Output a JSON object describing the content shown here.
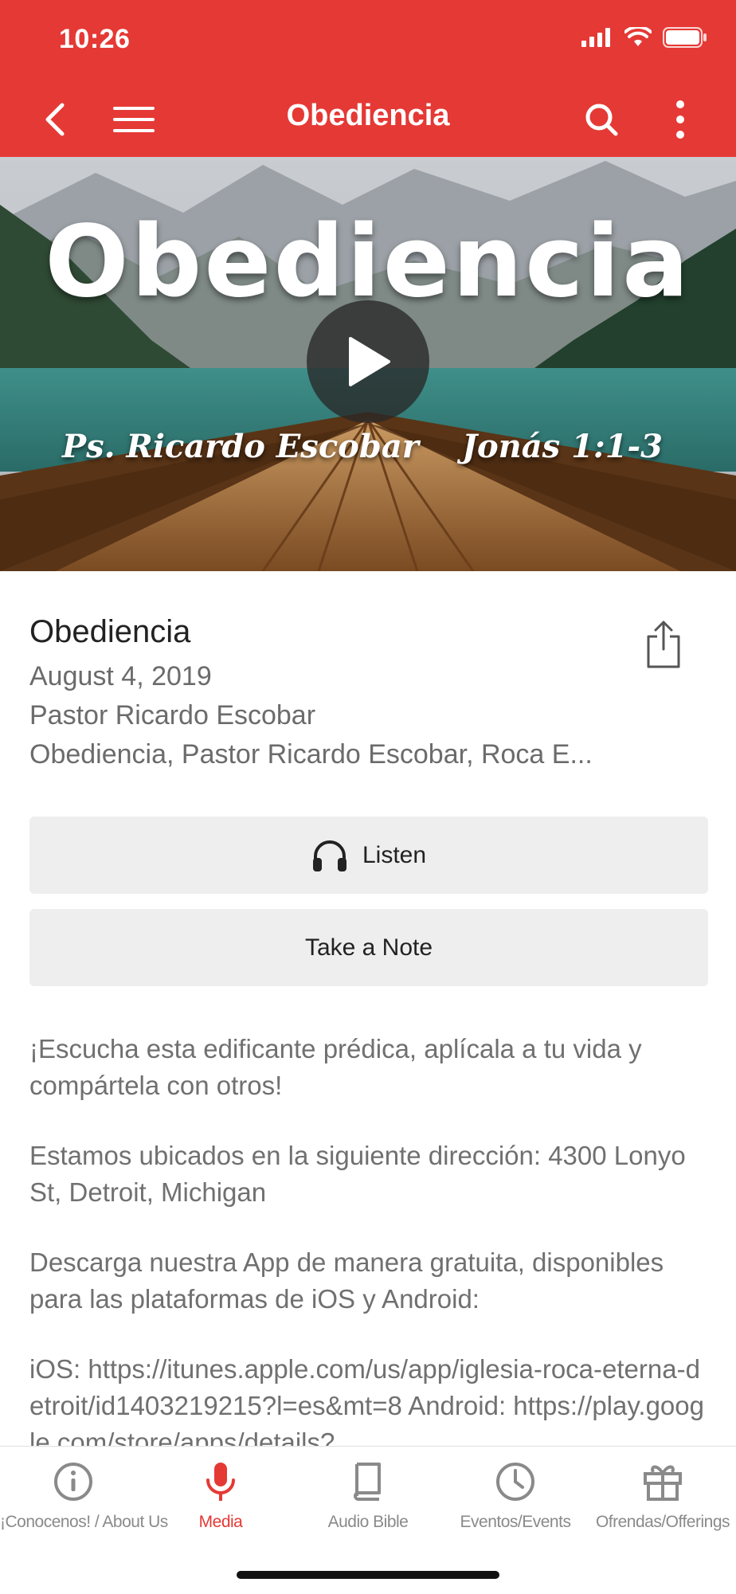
{
  "status": {
    "time": "10:26"
  },
  "nav": {
    "title": "Obediencia",
    "back_icon": "chevron-left-icon",
    "menu_icon": "hamburger-icon",
    "search_icon": "search-icon",
    "more_icon": "more-vertical-icon"
  },
  "hero": {
    "title": "Obediencia",
    "speaker": "Ps. Ricardo Escobar",
    "reference": "Jonás 1:1-3"
  },
  "sermon": {
    "title": "Obediencia",
    "date": "August 4, 2019",
    "speaker": "Pastor Ricardo Escobar",
    "tags": "Obediencia, Pastor Ricardo Escobar, Roca E..."
  },
  "actions": {
    "listen_label": "Listen",
    "note_label": "Take a Note"
  },
  "description": {
    "p1": "¡Escucha esta edificante prédica, aplícala a tu vida y compártela con otros!",
    "p2": "Estamos ubicados en la siguiente dirección: 4300 Lonyo St, Detroit, Michigan",
    "p3": "Descarga nuestra App de manera gratuita, disponibles para las plataformas de iOS y Android:",
    "p4": "iOS: https://itunes.apple.com/us/app/iglesia-roca-eterna-detroit/id1403219215?l=es&mt=8 Android: https://play.google.com/store/apps/details?"
  },
  "tabs": [
    {
      "label": "¡Conocenos! / About Us",
      "icon": "info-icon"
    },
    {
      "label": "Media",
      "icon": "microphone-icon",
      "active": true
    },
    {
      "label": "Audio Bible",
      "icon": "book-icon"
    },
    {
      "label": "Eventos/Events",
      "icon": "clock-icon"
    },
    {
      "label": "Ofrendas/Offerings",
      "icon": "gift-icon"
    }
  ],
  "colors": {
    "accent": "#e53935",
    "button_bg": "#eeeeef"
  }
}
